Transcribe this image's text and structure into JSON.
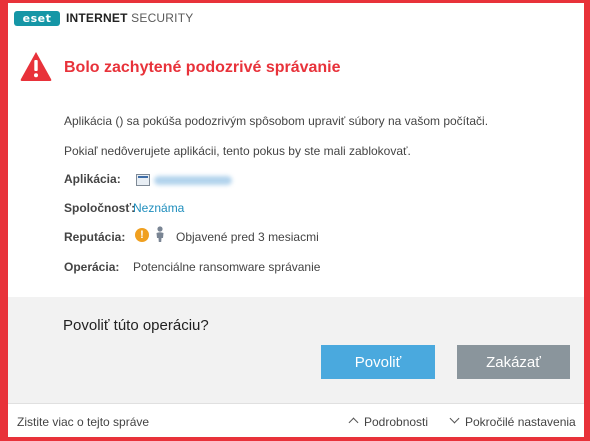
{
  "titlebar": {
    "brand": "eset",
    "product_prefix": "INTERNET",
    "product_suffix": "SECURITY"
  },
  "header": {
    "title": "Bolo zachytené podozrivé správanie"
  },
  "message": {
    "line1": "Aplikácia () sa pokúša podozrivým spôsobom upraviť súbory na vašom počítači.",
    "line2": "Pokiaľ nedôverujete aplikácii, tento pokus by ste mali zablokovať."
  },
  "details": {
    "app_label": "Aplikácia:",
    "company_label": "Spoločnosť:",
    "company_value": "Neznáma",
    "reputation_label": "Reputácia:",
    "reputation_value": "Objavené pred 3 mesiacmi",
    "operation_label": "Operácia:",
    "operation_value": "Potenciálne ransomware správanie"
  },
  "prompt": {
    "question": "Povoliť túto operáciu?",
    "allow_label": "Povoliť",
    "deny_label": "Zakázať"
  },
  "footer": {
    "learn_more": "Zistite viac o tejto správe",
    "details": "Podrobnosti",
    "advanced": "Pokročilé nastavenia"
  },
  "colors": {
    "accent_red": "#e8323a",
    "brand_teal": "#1596a6",
    "allow_blue": "#4aa9de",
    "deny_gray": "#8a959c",
    "link_blue": "#1f8ebd"
  }
}
